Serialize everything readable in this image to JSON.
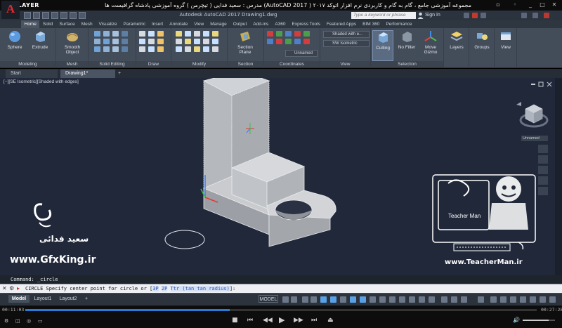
{
  "player": {
    "logo": "KMPLAYER",
    "title": "مجموعه آموزشی جامع ، گام به گام و کاربردی نرم افزار  اتوکد ۲۰۱۷ ( AutoCAD 2017)  مدرس : سعید فدایی ( تیچرمن ) گروه آموزشی پادشاه گرافیست ها",
    "time_elapsed": "00:11:03",
    "time_total": "00:27:28",
    "progress_fraction": 0.4
  },
  "autocad": {
    "app_letter": "A",
    "doc_title": "Autodesk AutoCAD 2017    Drawing1.dwg",
    "search_placeholder": "Type a keyword or phrase",
    "sign_in": "Sign In",
    "ribbon_tabs": [
      "Home",
      "Solid",
      "Surface",
      "Mesh",
      "Visualize",
      "Parametric",
      "Insert",
      "Annotate",
      "View",
      "Manage",
      "Output",
      "Add-ins",
      "A360",
      "Express Tools",
      "Featured Apps",
      "BIM 360",
      "Performance"
    ],
    "active_tab": "Home",
    "tools": {
      "sphere": "Sphere",
      "extrude": "Extrude",
      "smooth_object": "Smooth Object",
      "section_plane": "Section Plane",
      "culling": "Culling",
      "no_filter": "No Filter",
      "move_gizmo": "Move Gizmo",
      "layers": "Layers",
      "groups": "Groups",
      "view": "View"
    },
    "dropdowns": {
      "visual_style": "Shaded with e...",
      "view_preset": "SW Isometric",
      "ucs": "Unnamed"
    },
    "panel_labels": [
      "Modeling",
      "Mesh",
      "Solid Editing",
      "Draw",
      "Modify",
      "Section",
      "Coordinates",
      "View",
      "Selection"
    ],
    "file_tabs": [
      "Start",
      "Drawing1*"
    ],
    "viewport_label": "[−][SE Isometric][Shaded with edges]",
    "viewcube_dropdown": "Unnamed",
    "command_history": "Command: _circle",
    "command_prompt": "CIRCLE Specify center point for circle or [",
    "command_options": [
      "3P",
      "2P",
      "Ttr (tan tan radius)"
    ],
    "command_suffix": "]:",
    "layout_tabs": [
      "Model",
      "Layout1",
      "Layout2"
    ],
    "status_model": "MODEL"
  },
  "watermarks": {
    "gfxking_url": "www.GfxKing.ir",
    "saeed_name": "سعید فدائی",
    "teacherman_url": "www.TeacherMan.ir",
    "teacherman_name": "Teacher Man"
  },
  "colors": {
    "viewport_bg": "#21283a",
    "ribbon_bg": "#434c59",
    "accent_red": "#e8262b",
    "seek_blue": "#2a7bd4"
  }
}
